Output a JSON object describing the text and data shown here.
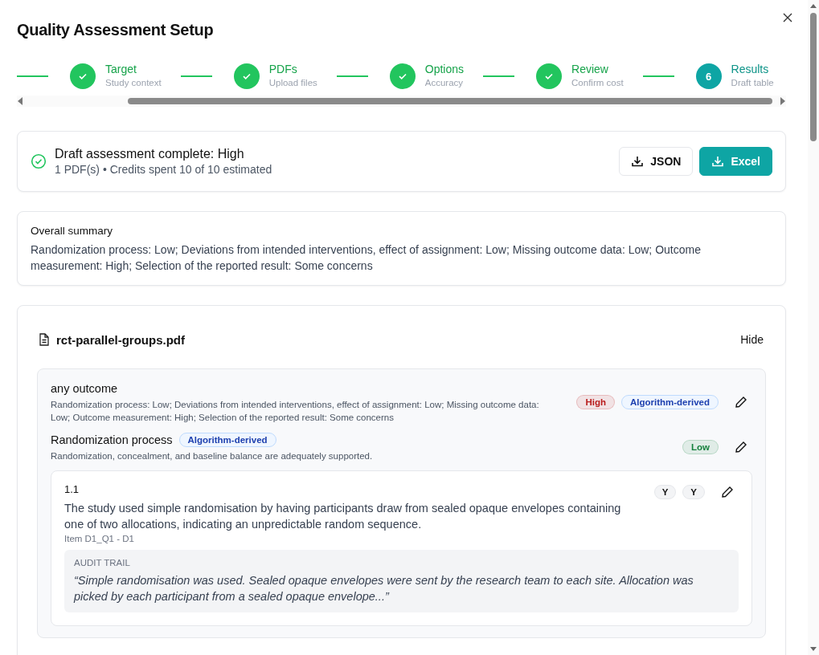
{
  "dialog": {
    "title": "Quality Assessment Setup"
  },
  "steps": [
    {
      "label": "Target",
      "sublabel": "Study context",
      "completed": true
    },
    {
      "label": "PDFs",
      "sublabel": "Upload files",
      "completed": true
    },
    {
      "label": "Options",
      "sublabel": "Accuracy",
      "completed": true
    },
    {
      "label": "Review",
      "sublabel": "Confirm cost",
      "completed": true
    },
    {
      "number": "6",
      "label": "Results",
      "sublabel": "Draft table",
      "completed": false
    }
  ],
  "status_card": {
    "title": "Draft assessment complete: High",
    "detail": "1 PDF(s) • Credits spent 10 of 10 estimated",
    "buttons": [
      {
        "label": "JSON",
        "kind": "outline"
      },
      {
        "label": "Excel",
        "kind": "primary"
      }
    ]
  },
  "overall_summary": {
    "heading": "Overall summary",
    "text": "Randomization process: Low; Deviations from intended interventions, effect of assignment: Low; Missing outcome data: Low; Outcome measurement: High; Selection of the reported result: Some concerns"
  },
  "file": {
    "name": "rct-parallel-groups.pdf",
    "toggle": "Hide",
    "outcome": {
      "title": "any outcome",
      "text": "Randomization process: Low; Deviations from intended interventions, effect of assignment: Low; Missing outcome data: Low; Outcome measurement: High; Selection of the reported result: Some concerns",
      "risk": {
        "label": "High",
        "color": "#b91c1c"
      },
      "source": "Algorithm-derived"
    },
    "domain": {
      "title": "Randomization process",
      "source": "Algorithm-derived",
      "text": "Randomization, concealment, and baseline balance are adequately supported.",
      "risk": {
        "label": "Low",
        "color": "#15803d"
      }
    },
    "question": {
      "id": "1.1",
      "text": "The study used simple randomisation by having participants draw from sealed opaque envelopes containing one of two allocations, indicating an unpredictable random sequence.",
      "meta": "Item D1_Q1 - D1",
      "answers": [
        "Y",
        "Y"
      ],
      "audit_heading": "AUDIT TRAIL",
      "audit_quote": "“Simple randomisation was used. Sealed opaque envelopes were sent by the research team to each site. Allocation was picked by each participant from a sealed opaque envelope...”"
    }
  }
}
